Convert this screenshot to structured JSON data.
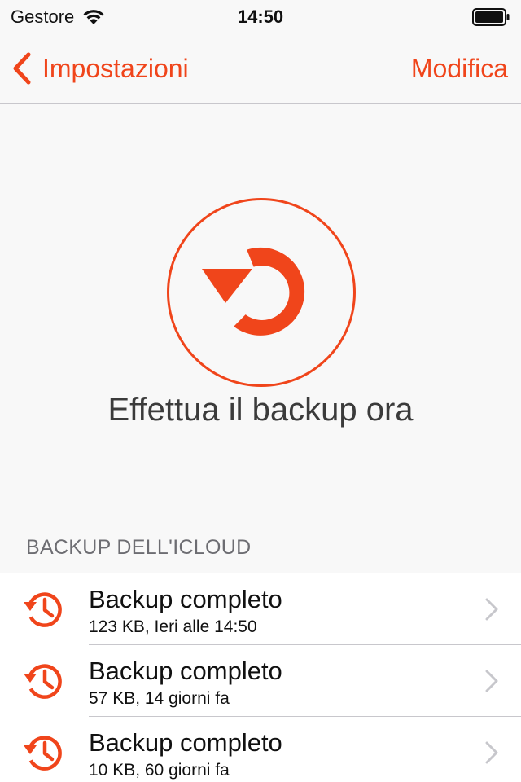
{
  "status_bar": {
    "carrier": "Gestore",
    "time": "14:50",
    "wifi_icon": "wifi-icon",
    "battery_icon": "battery-icon"
  },
  "nav": {
    "back_label": "Impostazioni",
    "edit_label": "Modifica",
    "back_icon": "chevron-left-icon"
  },
  "hero": {
    "button_label": "Effettua il backup ora",
    "icon": "backup-refresh-icon"
  },
  "section": {
    "title": "BACKUP DELL'ICLOUD"
  },
  "backups": [
    {
      "title": "Backup completo",
      "subtitle": "123 KB, Ieri alle 14:50",
      "icon": "history-icon"
    },
    {
      "title": "Backup completo",
      "subtitle": "57 KB, 14 giorni fa",
      "icon": "history-icon"
    },
    {
      "title": "Backup completo",
      "subtitle": "10 KB, 60 giorni fa",
      "icon": "history-icon"
    }
  ],
  "colors": {
    "accent": "#f0451b",
    "background": "#f8f8f8",
    "separator": "#c8c7cc",
    "chevron": "#c7c7cc"
  }
}
